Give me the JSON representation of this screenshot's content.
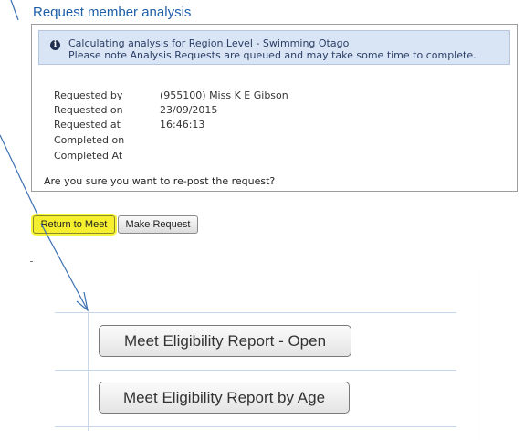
{
  "page_title": "Request member analysis",
  "info": {
    "icon": "info-icon",
    "line1": "Calculating analysis for Region Level - Swimming Otago",
    "line2": "Please note Analysis Requests are queued and may take some time to complete."
  },
  "details": [
    {
      "label": "Requested by",
      "value": "(955100) Miss K E Gibson"
    },
    {
      "label": "Requested on",
      "value": "23/09/2015"
    },
    {
      "label": "Requested at",
      "value": "16:46:13"
    },
    {
      "label": "Completed on",
      "value": ""
    },
    {
      "label": "Completed At",
      "value": ""
    }
  ],
  "confirm_text": "Are you sure you want to re-post the request?",
  "buttons": {
    "return_to_meet": "Return to Meet",
    "make_request": "Make Request"
  },
  "reports": {
    "open": "Meet Eligibility Report - Open",
    "by_age": "Meet Eligibility Report by Age"
  },
  "colors": {
    "title": "#1f5fa8",
    "info_bg": "#d9e4f5",
    "highlight": "#f5ef2f",
    "arrow": "#3b6fb0"
  }
}
